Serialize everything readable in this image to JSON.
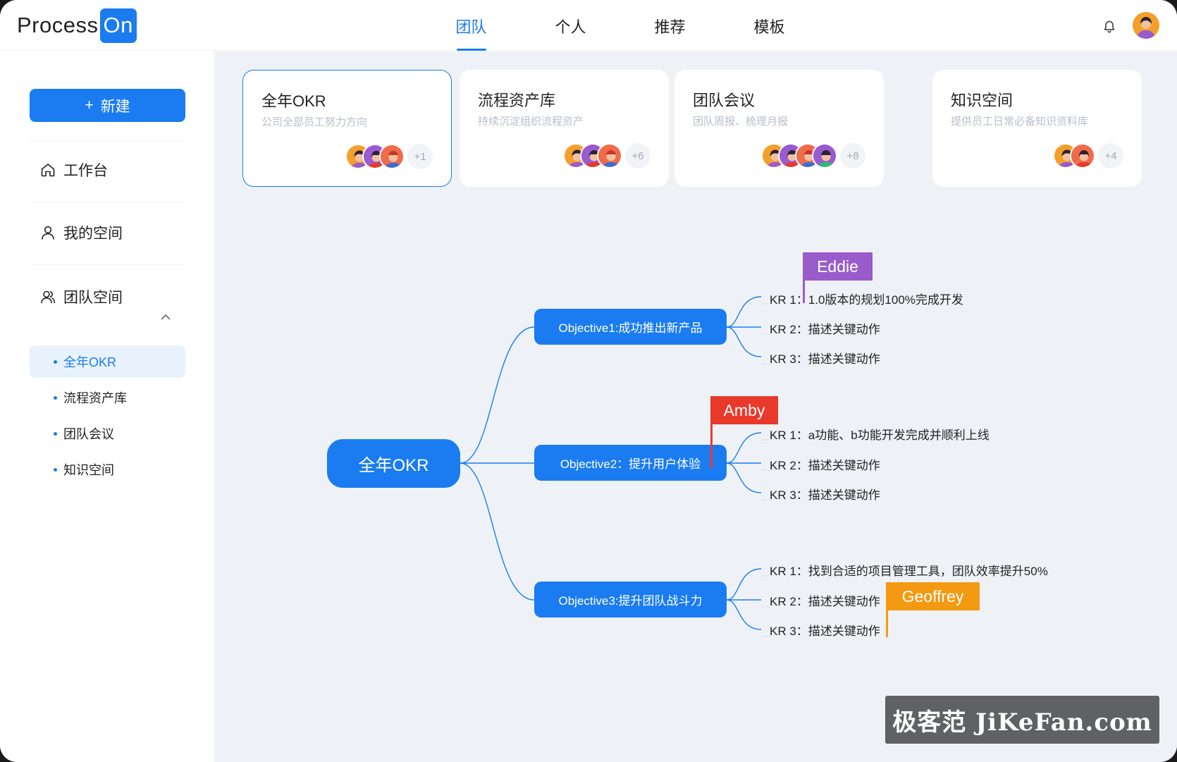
{
  "header": {
    "logo_text": "Process",
    "logo_badge": "On",
    "nav": [
      "团队",
      "个人",
      "推荐",
      "模板"
    ],
    "active_nav": "团队"
  },
  "sidebar": {
    "new_label": "新建",
    "items": [
      {
        "label": "工作台",
        "icon": "home-icon"
      },
      {
        "label": "我的空间",
        "icon": "user-icon"
      },
      {
        "label": "团队空间",
        "icon": "team-icon"
      }
    ],
    "sub_items": [
      "全年OKR",
      "流程资产库",
      "团队会议",
      "知识空间"
    ],
    "active_sub": "全年OKR"
  },
  "cards": [
    {
      "title": "全年OKR",
      "subtitle": "公司全部员工努力方向",
      "more": "+1"
    },
    {
      "title": "流程资产库",
      "subtitle": "持续沉淀组织流程资产",
      "more": "+6"
    },
    {
      "title": "团队会议",
      "subtitle": "团队周报、梳理月报",
      "more": "+8"
    },
    {
      "title": "知识空间",
      "subtitle": "提供员工日常必备知识资料库",
      "more": "+4"
    }
  ],
  "mindmap": {
    "root": "全年OKR",
    "objectives": [
      {
        "label": "Objective1:成功推出新产品",
        "krs": [
          "KR 1：1.0版本的规划100%完成开发",
          "KR 2：描述关键动作",
          "KR 3：描述关键动作"
        ]
      },
      {
        "label": "Objective2：提升用户体验",
        "krs": [
          "KR 1：a功能、b功能开发完成并顺利上线",
          "KR 2：描述关键动作",
          "KR 3：描述关键动作"
        ]
      },
      {
        "label": "Objective3:提升团队战斗力",
        "krs": [
          "KR 1：找到合适的项目管理工具，团队效率提升50%",
          "KR 2：描述关键动作",
          "KR 3：描述关键动作"
        ]
      }
    ],
    "flags": [
      {
        "name": "Eddie",
        "color": "#9b5ccb"
      },
      {
        "name": "Amby",
        "color": "#e8392b"
      },
      {
        "name": "Geoffrey",
        "color": "#f39a12"
      }
    ]
  },
  "watermark": "极客范 JiKeFan.com",
  "colors": {
    "accent": "#1a7cf0",
    "main_bg": "#eef2f7"
  }
}
